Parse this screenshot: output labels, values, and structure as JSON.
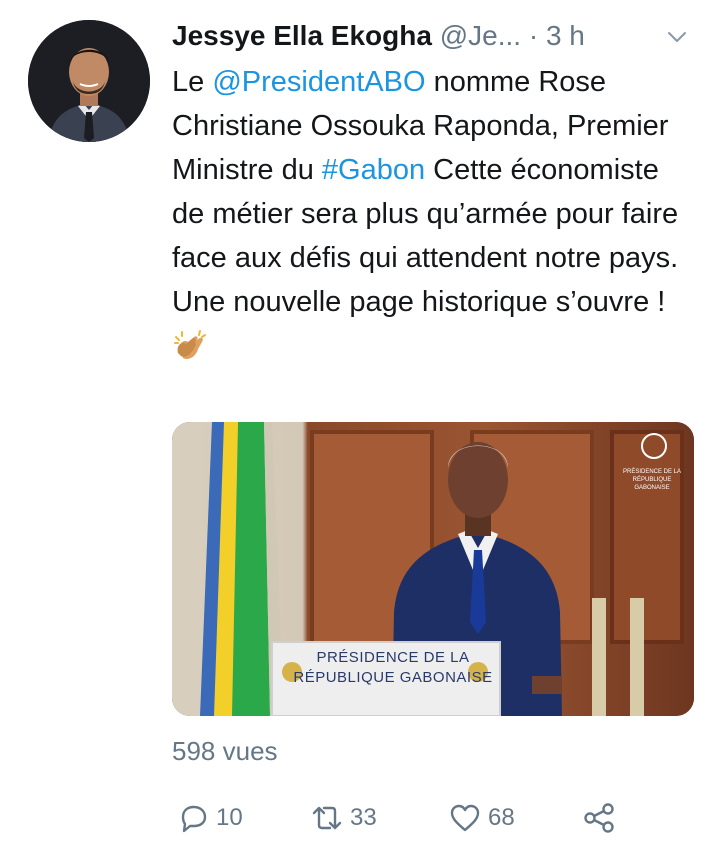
{
  "tweet": {
    "author_name": "Jessye Ella Ekogha",
    "author_handle": "@Je...",
    "time": "· 3 h",
    "text": {
      "t1": "Le ",
      "mention": "@PresidentABO",
      "t2": " nomme Rose Christiane Ossouka Raponda, Premier Ministre du ",
      "hashtag": "#Gabon",
      "t3": " Cette économiste de métier sera plus qu’armée pour faire face aux défis qui attendent notre pays. Une nouvelle page historique s’ouvre !"
    },
    "emoji": "clapping-hands",
    "media": {
      "lectern_line1": "PRÉSIDENCE DE LA",
      "lectern_line2": "RÉPUBLIQUE GABONAISE",
      "watermark_line1": "PRÉSIDENCE DE LA",
      "watermark_line2": "RÉPUBLIQUE GABONAISE"
    },
    "views": "598 vues",
    "actions": {
      "replies": "10",
      "retweets": "33",
      "likes": "68"
    }
  },
  "colors": {
    "link": "#1b95e0",
    "muted": "#657786",
    "text": "#14171a"
  },
  "icons": [
    "chevron-down-icon",
    "reply-icon",
    "retweet-icon",
    "like-icon",
    "share-icon"
  ]
}
